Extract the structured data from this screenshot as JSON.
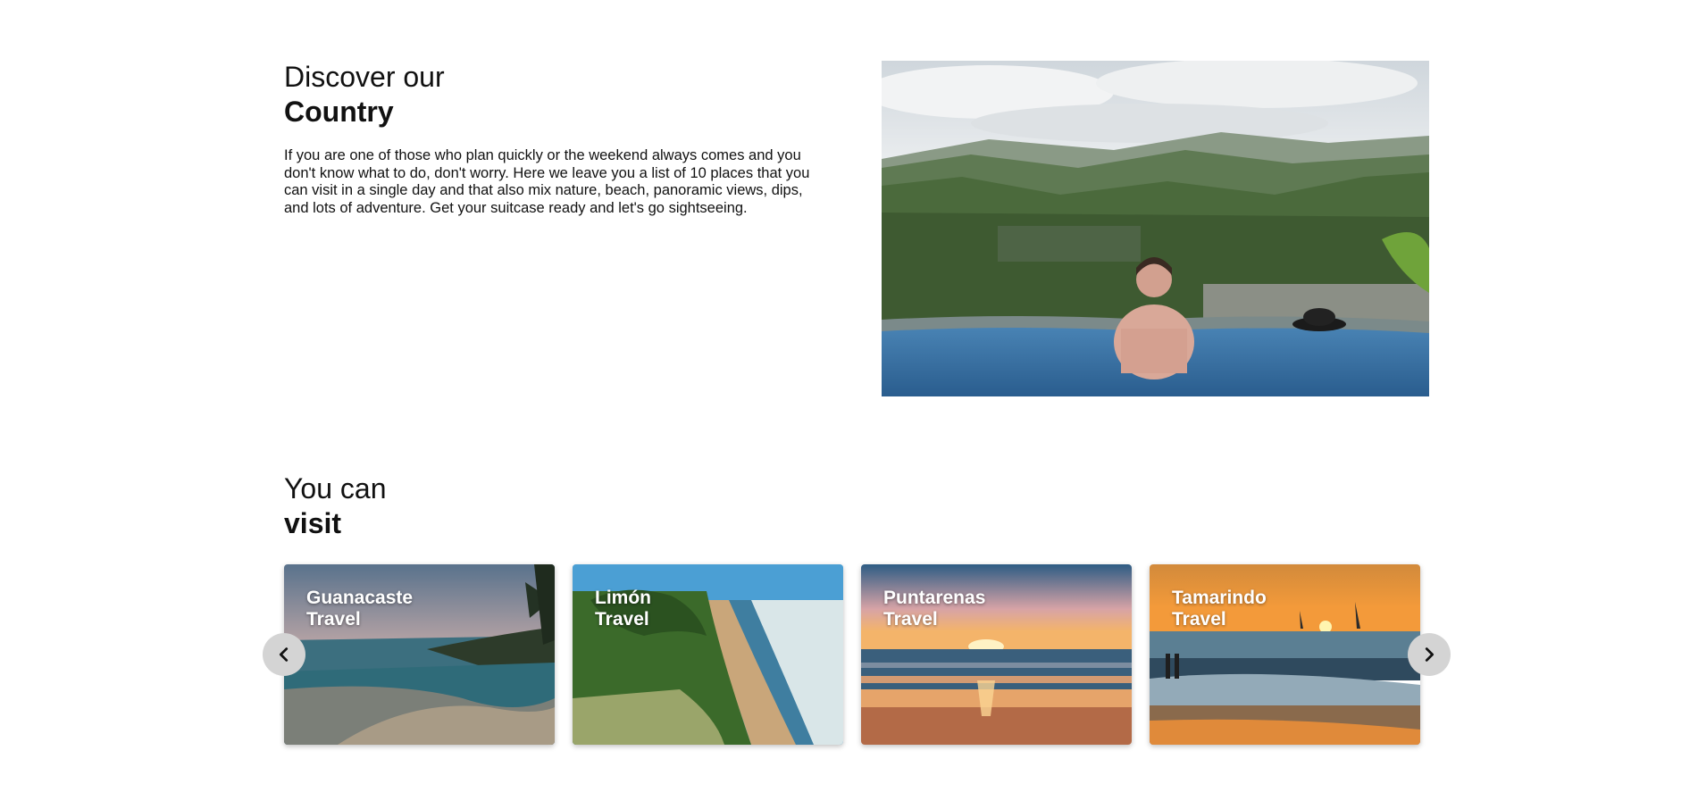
{
  "discover": {
    "title_light": "Discover our",
    "title_bold": "Country",
    "description": "If you are one of those who plan quickly or the weekend always comes and you don't know what to do, don't worry. Here we leave you a list of 10 places that you can visit in a single day and that also mix nature, beach, panoramic views, dips, and lots of adventure. Get your suitcase ready and let's go sightseeing."
  },
  "visit": {
    "title_light": "You can",
    "title_bold": "visit"
  },
  "carousel": {
    "prev_icon": "chevron-left-icon",
    "next_icon": "chevron-right-icon",
    "cards": [
      {
        "place": "Guanacaste",
        "suffix": "Travel"
      },
      {
        "place": "Limón",
        "suffix": "Travel"
      },
      {
        "place": "Puntarenas",
        "suffix": "Travel"
      },
      {
        "place": "Tamarindo",
        "suffix": "Travel"
      }
    ]
  }
}
